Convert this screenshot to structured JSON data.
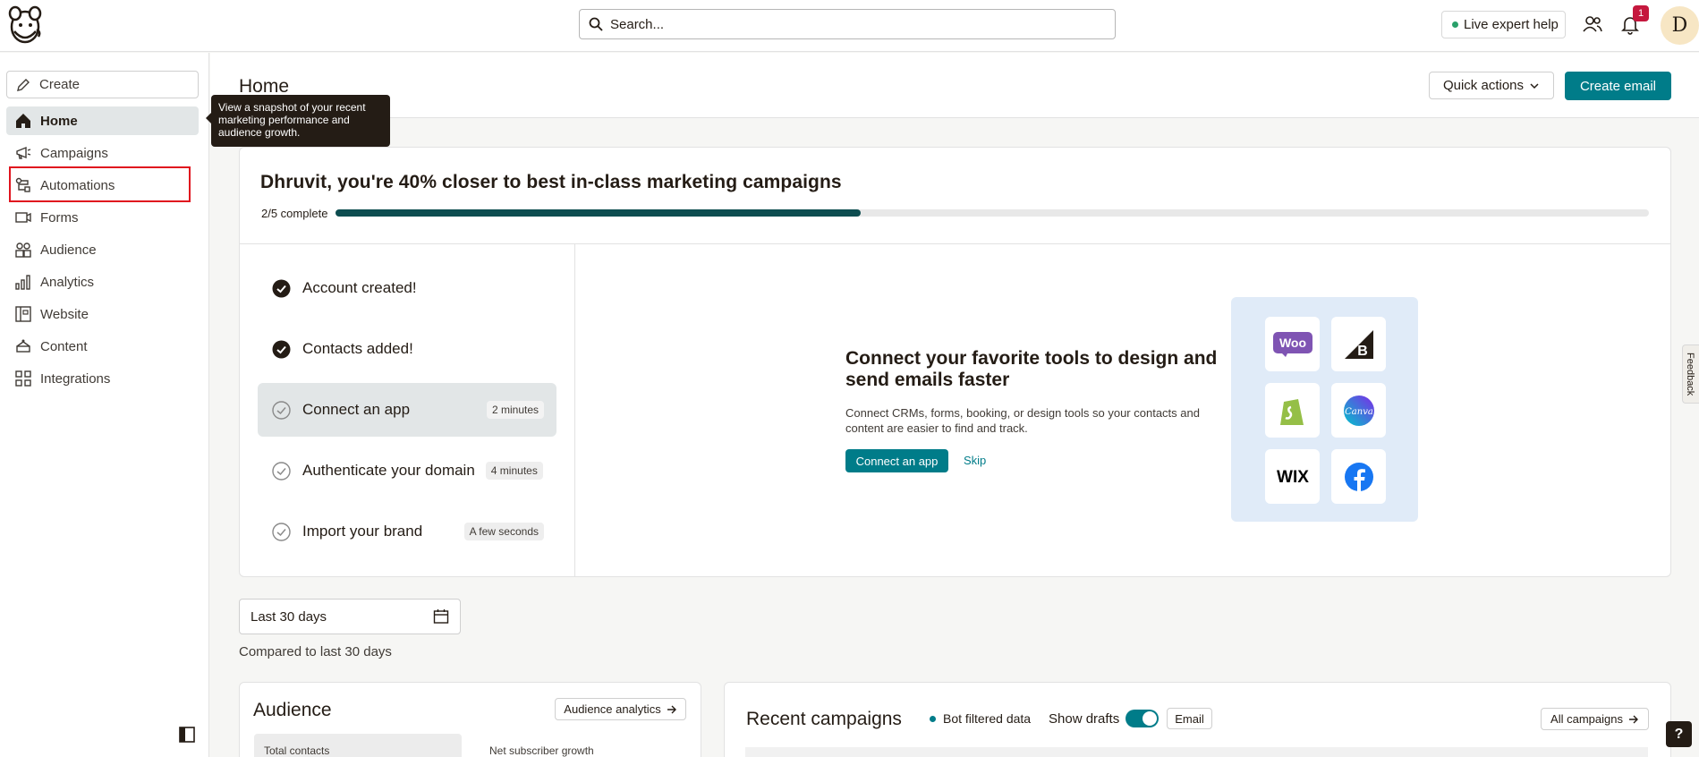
{
  "topbar": {
    "search_placeholder": "Search...",
    "live_help": "Live expert help",
    "notification_count": "1",
    "avatar_initial": "D"
  },
  "sidebar": {
    "create_label": "Create",
    "items": [
      {
        "label": "Home",
        "icon": "home-icon",
        "active": true
      },
      {
        "label": "Campaigns",
        "icon": "megaphone-icon"
      },
      {
        "label": "Automations",
        "icon": "automation-icon"
      },
      {
        "label": "Forms",
        "icon": "form-icon"
      },
      {
        "label": "Audience",
        "icon": "audience-icon"
      },
      {
        "label": "Analytics",
        "icon": "bar-chart-icon"
      },
      {
        "label": "Website",
        "icon": "website-icon"
      },
      {
        "label": "Content",
        "icon": "content-icon"
      },
      {
        "label": "Integrations",
        "icon": "grid-icon"
      }
    ],
    "tooltip": "View a snapshot of your recent marketing performance and audience growth."
  },
  "header": {
    "title": "Home",
    "quick_actions": "Quick actions",
    "create_email": "Create email"
  },
  "onboarding": {
    "title": "Dhruvit, you're 40% closer to best in-class marketing campaigns",
    "progress_label": "2/5 complete",
    "progress_fraction": 0.4,
    "steps": [
      {
        "label": "Account created!",
        "done": true
      },
      {
        "label": "Contacts added!",
        "done": true
      },
      {
        "label": "Connect an app",
        "badge": "2 minutes"
      },
      {
        "label": "Authenticate your domain",
        "badge": "4 minutes"
      },
      {
        "label": "Import your brand",
        "badge": "A few seconds"
      }
    ],
    "promo": {
      "title": "Connect your favorite tools to design and send emails faster",
      "description": "Connect CRMs, forms, booking, or design tools so your contacts and content are easier to find and track.",
      "primary": "Connect an app",
      "skip": "Skip",
      "apps": [
        "woocommerce-icon",
        "bigcommerce-icon",
        "shopify-icon",
        "canva-icon",
        "wix-icon",
        "facebook-icon"
      ],
      "woo_text": "Woo",
      "wix_text": "WIX",
      "canva_text": "Canva"
    }
  },
  "filters": {
    "date_range": "Last 30 days",
    "compared": "Compared to last 30 days"
  },
  "audience": {
    "title": "Audience",
    "analytics_btn": "Audience analytics",
    "total_contacts": "Total contacts",
    "net_growth": "Net subscriber growth"
  },
  "campaigns": {
    "title": "Recent campaigns",
    "bot_filtered": "Bot filtered data",
    "show_drafts": "Show drafts",
    "email_filter": "Email",
    "all_btn": "All campaigns"
  },
  "feedback": "Feedback",
  "help": "?",
  "colors": {
    "brand_teal": "#007c89",
    "progress_dark": "#0d4d50",
    "highlight_red": "#e0141e",
    "notification_red": "#c5183e"
  }
}
